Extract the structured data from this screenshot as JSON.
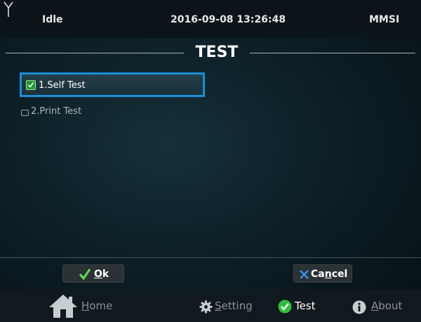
{
  "status": {
    "state": "Idle",
    "datetime": "2016-09-08 13:26:48",
    "mmsi_label": "MMSI"
  },
  "title": "TEST",
  "items": [
    {
      "label": "1.Self Test",
      "checked": true,
      "selected": true
    },
    {
      "label": "2.Print Test",
      "checked": false,
      "selected": false
    }
  ],
  "buttons": {
    "ok": {
      "prefix": "",
      "mnemonic": "O",
      "rest": "k"
    },
    "cancel": {
      "prefix": "Ca",
      "mnemonic": "n",
      "rest": "cel"
    }
  },
  "nav": [
    {
      "id": "home",
      "icon": "home-icon",
      "prefix": "",
      "mnemonic": "H",
      "rest": "ome",
      "active": false
    },
    {
      "id": "setting",
      "icon": "gear-icon",
      "prefix": "",
      "mnemonic": "S",
      "rest": "etting",
      "active": false
    },
    {
      "id": "test",
      "icon": "check-circle-icon",
      "prefix": "",
      "mnemonic": "",
      "rest": "Test",
      "active": true
    },
    {
      "id": "about",
      "icon": "info-icon",
      "prefix": "",
      "mnemonic": "A",
      "rest": "bout",
      "active": false
    }
  ],
  "colors": {
    "selection_border": "#1a8fd8",
    "check_green": "#1e9a2e",
    "cancel_x_blue": "#3d8fe6",
    "ok_check_green": "#5ce04c"
  }
}
